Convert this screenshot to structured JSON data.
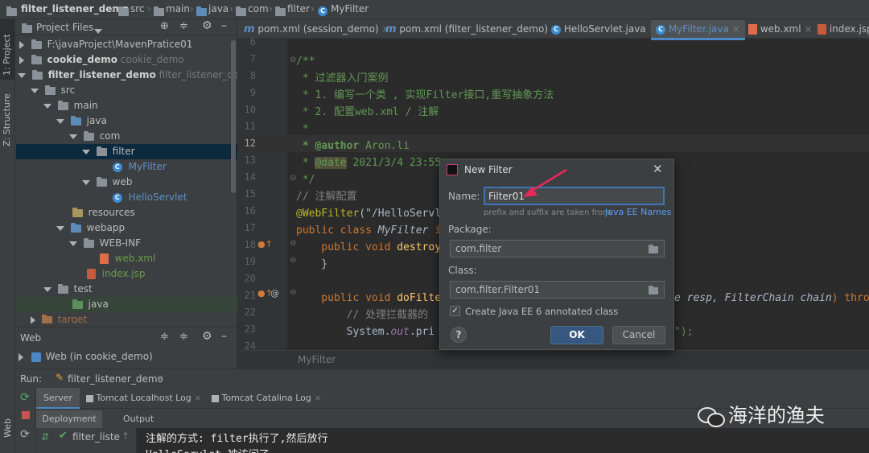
{
  "breadcrumb": [
    "filter_listener_demo",
    "src",
    "main",
    "java",
    "com",
    "filter",
    "MyFilter"
  ],
  "side_tabs": {
    "project": "1: Project",
    "structure": "Z: Structure",
    "web": "Web"
  },
  "project_panel": {
    "title": "Project Files",
    "tree": [
      {
        "label": "F:\\javaProject\\MavenPratice01",
        "extra": "",
        "icon": "folder"
      },
      {
        "label": "cookie_demo",
        "extra": "cookie_demo",
        "icon": "folder"
      },
      {
        "label": "filter_listener_demo",
        "extra": "filter_listener_demo",
        "icon": "folder"
      },
      {
        "label": "src",
        "extra": "",
        "icon": "folder"
      },
      {
        "label": "main",
        "extra": "",
        "icon": "folder"
      },
      {
        "label": "java",
        "extra": "",
        "icon": "folder-blue"
      },
      {
        "label": "com",
        "extra": "",
        "icon": "folder"
      },
      {
        "label": "filter",
        "extra": "",
        "icon": "folder"
      },
      {
        "label": "MyFilter",
        "extra": "",
        "icon": "class"
      },
      {
        "label": "web",
        "extra": "",
        "icon": "folder"
      },
      {
        "label": "HelloServlet",
        "extra": "",
        "icon": "class"
      },
      {
        "label": "resources",
        "extra": "",
        "icon": "folder-yellow"
      },
      {
        "label": "webapp",
        "extra": "",
        "icon": "folder-blue"
      },
      {
        "label": "WEB-INF",
        "extra": "",
        "icon": "folder"
      },
      {
        "label": "web.xml",
        "extra": "",
        "icon": "xml"
      },
      {
        "label": "index.jsp",
        "extra": "",
        "icon": "jsp"
      },
      {
        "label": "test",
        "extra": "",
        "icon": "folder"
      },
      {
        "label": "java",
        "extra": "",
        "icon": "folder-green"
      },
      {
        "label": "target",
        "extra": "",
        "icon": "folder-orange"
      }
    ]
  },
  "web_panel": {
    "title": "Web",
    "item": "Web (in cookie_demo)"
  },
  "editor_tabs": [
    {
      "label": "pom.xml (session_demo)",
      "icon": "m"
    },
    {
      "label": "pom.xml (filter_listener_demo)",
      "icon": "m"
    },
    {
      "label": "HelloServlet.java",
      "icon": "c"
    },
    {
      "label": "MyFilter.java",
      "icon": "c",
      "active": true
    },
    {
      "label": "web.xml",
      "icon": "xml"
    },
    {
      "label": "index.jsp",
      "icon": "jsp"
    }
  ],
  "line_numbers": [
    "6",
    "7",
    "8",
    "9",
    "10",
    "11",
    "12",
    "13",
    "14",
    "15",
    "16",
    "17",
    "18",
    "19",
    "20",
    "21",
    "22",
    "23",
    "24"
  ],
  "code": {
    "l7": "/**",
    "l8": " * 过滤器入门案例",
    "l9": " * 1. 编写一个类 , 实现Filter接口,重写抽象方法",
    "l10": " * 2. 配置web.xml / 注解",
    "l11": " *",
    "l12_a": " * @author",
    "l12_b": " Aron.li",
    "l13_a": " * ",
    "l13_tag": "@date",
    "l13_b": " 2021/3/4 23:55",
    "l14": " */",
    "l15": "// 注解配置",
    "l16_a": "@WebFilter",
    "l16_b": "(\"/HelloServl",
    "l17_a": "public class ",
    "l17_b": "MyFilter",
    "l17_c": " i",
    "l18_a": "    public void ",
    "l18_b": "destroy",
    "l19": "    }",
    "l21_a": "    public void ",
    "l21_b": "doFilte",
    "l21_c": "e resp, ",
    "l21_d": "FilterChain chain",
    "l21_e": ") thro",
    "l22": "        // 处理拦截器的",
    "l23_a": "        System.",
    "l23_b": "out",
    "l23_c": ".pri",
    "l23_d": "\");"
  },
  "editor_breadcrumb": "MyFilter",
  "dialog": {
    "title": "New Filter",
    "name_label": "Name:",
    "name_value": "Filter01",
    "hint": "prefix and suffix are taken from",
    "hint_link": "Java EE Names",
    "package_label": "Package:",
    "package_value": "com.filter",
    "class_label": "Class:",
    "class_value": "com.filter.Filter01",
    "checkbox_label": "Create Java EE 6 annotated class",
    "checkbox_checked": true,
    "ok": "OK",
    "cancel": "Cancel",
    "help": "?"
  },
  "run_panel": {
    "label": "Run:",
    "config": "filter_listener_demo",
    "tabs": [
      "Server",
      "Tomcat Localhost Log",
      "Tomcat Catalina Log"
    ],
    "sub_tabs": [
      "Deployment",
      "Output"
    ],
    "deploy_item": "filter_liste",
    "output_lines": [
      "注解的方式: filter执行了,然后放行",
      "HelloServlet 被访问了"
    ]
  },
  "watermark": "海洋的渔夫",
  "colors": {
    "accent": "#4a88c7",
    "arrow": "#e8295b",
    "selection": "#0d293e",
    "panel": "#3c3f41"
  }
}
